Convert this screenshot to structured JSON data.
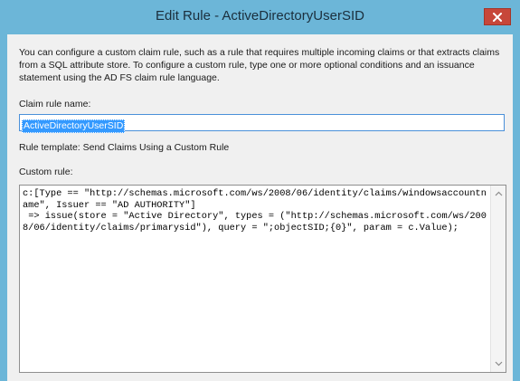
{
  "window": {
    "title": "Edit Rule - ActiveDirectoryUserSID"
  },
  "icons": {
    "close": "close-icon",
    "scroll_up": "chevron-up-icon",
    "scroll_down": "chevron-down-icon"
  },
  "colors": {
    "title_bar": "#6cb6d8",
    "close_button": "#c7473a",
    "selection": "#3399ff",
    "input_border": "#4a90d9"
  },
  "content": {
    "description": "You can configure a custom claim rule, such as a rule that requires multiple incoming claims or that extracts claims from a SQL attribute store. To configure a custom rule, type one or more optional conditions and an issuance statement using the AD FS claim rule language.",
    "claim_rule_name_label": "Claim rule name:",
    "claim_rule_name_value": "ActiveDirectoryUserSID",
    "rule_template": "Rule template: Send Claims Using a Custom Rule",
    "custom_rule_label": "Custom rule:",
    "custom_rule_value": "c:[Type == \"http://schemas.microsoft.com/ws/2008/06/identity/claims/windowsaccountname\", Issuer == \"AD AUTHORITY\"]\n => issue(store = \"Active Directory\", types = (\"http://schemas.microsoft.com/ws/2008/06/identity/claims/primarysid\"), query = \";objectSID;{0}\", param = c.Value);"
  }
}
